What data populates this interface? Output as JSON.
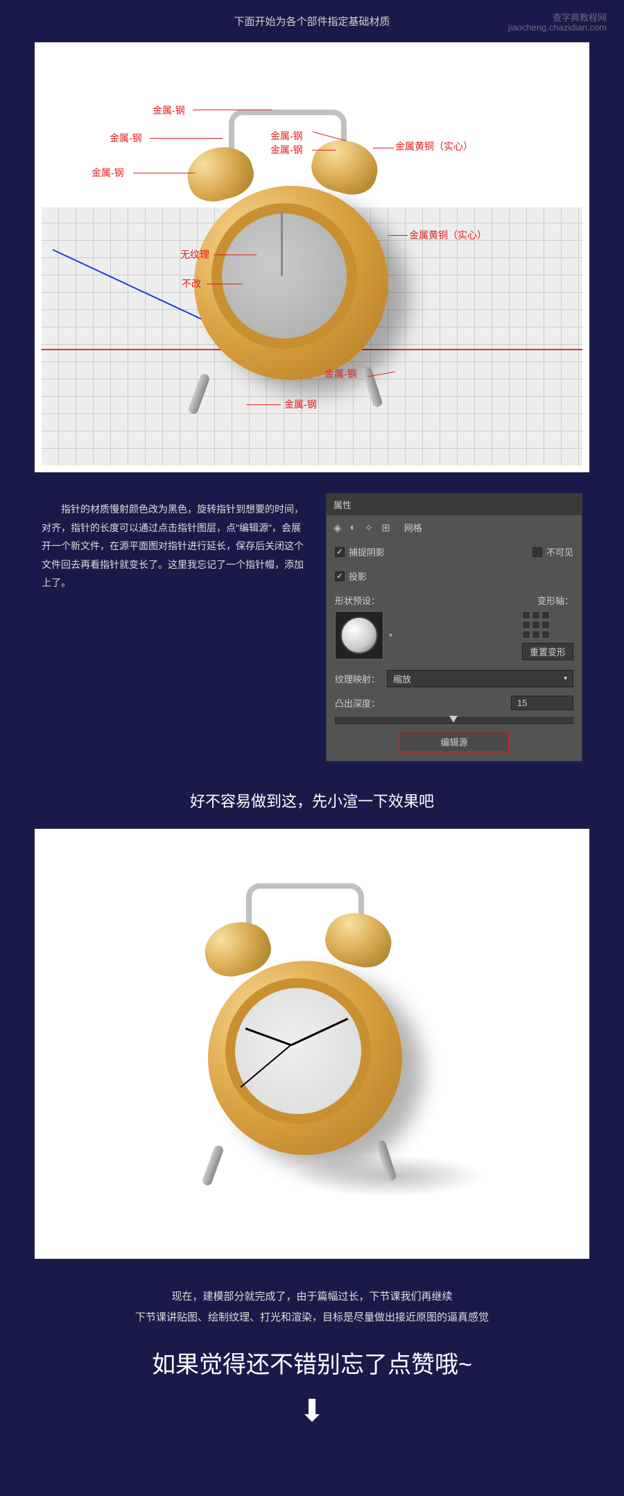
{
  "section_title": "下面开始为各个部件指定基础材质",
  "material_labels": {
    "steel1": "金属-钢",
    "steel2": "金属-钢",
    "steel3": "金属-钢",
    "steel4": "金属-钢",
    "steel5": "金属-钢",
    "steel6": "金属-钢",
    "steel7": "金属-钢",
    "brass_solid1": "金属黄铜（实心）",
    "brass_solid2": "金属黄铜（实心）",
    "texture_none": "无纹理",
    "no_change": "不改"
  },
  "paragraph": "指针的材质慢射颜色改为黑色，旋转指针到想要的时间，对齐，指针的长度可以通过点击指针图层，点\"编辑源\"，会展开一个新文件，在源平面图对指针进行延长，保存后关闭这个文件回去再看指针就变长了。这里我忘记了一个指针帽，添加上了。",
  "panel": {
    "title": "属性",
    "mesh_label": "网格",
    "catch_shadow": "捕捉阴影",
    "invisible": "不可见",
    "projection": "投影",
    "shape_preset": "形状预设：",
    "deform_axis": "变形轴：",
    "reset_deform": "重置变形",
    "texture_map": "纹理映射：",
    "texture_map_value": "缩放",
    "extrude_depth": "凸出深度：",
    "extrude_value": "15",
    "edit_source": "编辑源"
  },
  "render_subtitle": "好不容易做到这，先小渲一下效果吧",
  "outro_line1": "现在，建模部分就完成了，由于篇幅过长，下节课我们再继续",
  "outro_line2": "下节课讲贴图、绘制纹理、打光和渲染，目标是尽量做出接近原图的逼真感觉",
  "cta": "如果觉得还不错别忘了点赞哦~",
  "watermark_a": "查字典教程网",
  "watermark_b": "jiaocheng.chazidian.com"
}
